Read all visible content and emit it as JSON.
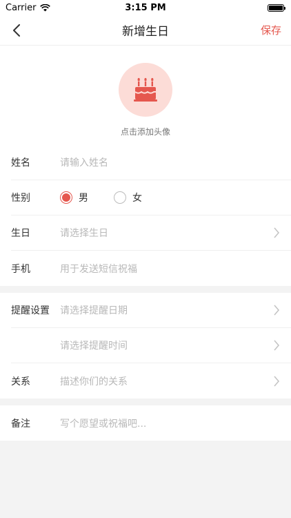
{
  "status_bar": {
    "carrier": "Carrier",
    "time": "3:15 PM"
  },
  "nav": {
    "title": "新增生日",
    "save_label": "保存"
  },
  "avatar": {
    "hint": "点击添加头像",
    "icon": "birthday-cake-icon"
  },
  "basic_info": {
    "name": {
      "label": "姓名",
      "placeholder": "请输入姓名"
    },
    "gender": {
      "label": "性别",
      "options": [
        "男",
        "女"
      ],
      "selected": "男"
    },
    "birthday": {
      "label": "生日",
      "placeholder": "请选择生日"
    },
    "phone": {
      "label": "手机",
      "placeholder": "用于发送短信祝福"
    }
  },
  "reminder": {
    "label": "提醒设置",
    "date_placeholder": "请选择提醒日期",
    "time_placeholder": "请选择提醒时间",
    "relation_label": "关系",
    "relation_placeholder": "描述你们的关系"
  },
  "notes": {
    "label": "备注",
    "placeholder": "写个愿望或祝福吧..."
  },
  "colors": {
    "accent": "#e5574e",
    "avatar_bg": "#fcdcd7"
  }
}
